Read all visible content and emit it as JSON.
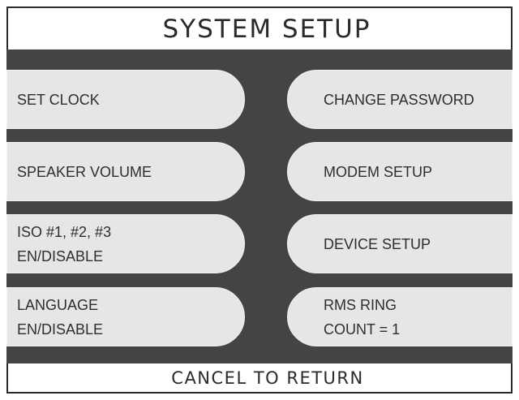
{
  "header": {
    "title": "SYSTEM SETUP"
  },
  "menu": {
    "left": [
      {
        "lines": [
          "SET CLOCK"
        ]
      },
      {
        "lines": [
          "SPEAKER VOLUME"
        ]
      },
      {
        "lines": [
          "ISO #1, #2, #3",
          "EN/DISABLE"
        ]
      },
      {
        "lines": [
          "LANGUAGE",
          "EN/DISABLE"
        ]
      }
    ],
    "right": [
      {
        "lines": [
          "CHANGE PASSWORD"
        ]
      },
      {
        "lines": [
          "MODEM SETUP"
        ]
      },
      {
        "lines": [
          "DEVICE SETUP"
        ]
      },
      {
        "lines": [
          "RMS RING",
          "COUNT = 1"
        ]
      }
    ]
  },
  "footer": {
    "label": "CANCEL TO RETURN"
  },
  "colors": {
    "panel": "#444444",
    "button": "#e6e6e6",
    "text": "#2a2a2a"
  }
}
